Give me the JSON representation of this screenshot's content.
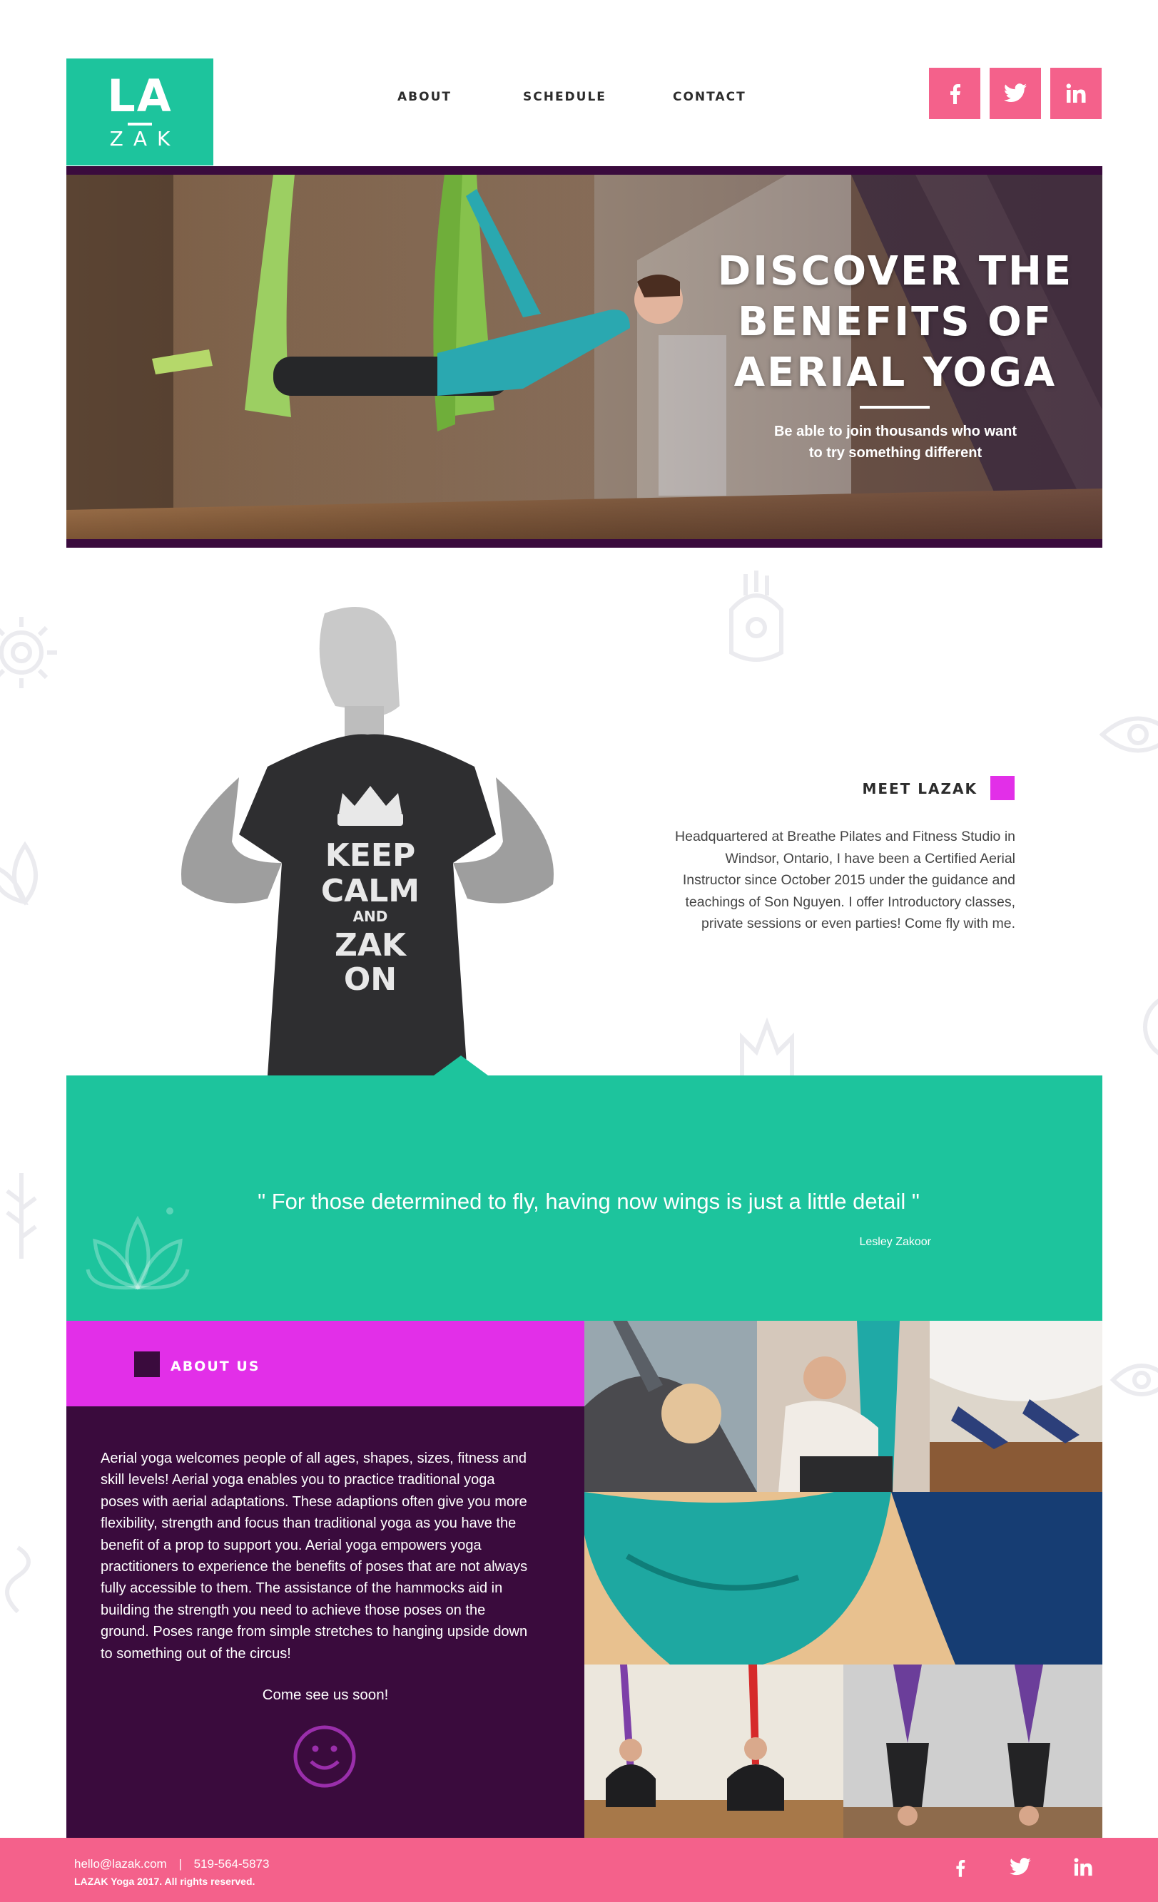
{
  "brand": {
    "logo_top": "LA",
    "logo_bottom": "ZAK",
    "accent_teal": "#1dc49d",
    "accent_pink": "#f4618b",
    "accent_magenta": "#e22fe8",
    "accent_plum": "#3a0b3d"
  },
  "nav": {
    "items": [
      "ABOUT",
      "SCHEDULE",
      "CONTACT"
    ]
  },
  "social": [
    "facebook-icon",
    "twitter-icon",
    "linkedin-icon"
  ],
  "hero": {
    "title_lines": [
      "DISCOVER THE",
      "BENEFITS OF",
      "AERIAL YOGA"
    ],
    "subtitle_lines": [
      "Be able to join thousands who want",
      "to try something different"
    ]
  },
  "meet": {
    "heading": "MEET LAZAK",
    "shirt_lines": [
      "KEEP",
      "CALM",
      "AND",
      "ZAK",
      "ON"
    ],
    "text_lines": [
      "Headquartered at Breathe Pilates and Fitness Studio in",
      "Windsor, Ontario, I have been a Certified Aerial",
      "Instructor since October 2015 under the guidance and",
      "teachings of Son Nguyen. I offer Introductory classes,",
      "private sessions or even parties! Come fly with me."
    ]
  },
  "quote": {
    "text": "\" For those determined to fly, having now wings is just a little detail \"",
    "author": "Lesley Zakoor"
  },
  "about": {
    "title": "ABOUT US",
    "text_lines": [
      "Aerial yoga welcomes people of all ages, shapes, sizes, fitness and",
      "skill levels! Aerial yoga enables you to practice traditional yoga",
      "poses with aerial adaptations. These adaptions often give you more",
      "flexibility, strength and focus than traditional yoga as you have the",
      "benefit of a prop to support you. Aerial yoga empowers yoga",
      "practitioners to experience the benefits of poses that are not always",
      "fully accessible to them. The assistance of the hammocks aid in",
      "building the strength you need to achieve those poses on the",
      "ground. Poses range from simple stretches to hanging upside down",
      "to something out of the circus!"
    ],
    "cta": "Come see us soon!"
  },
  "footer": {
    "email": "hello@lazak.com",
    "separator": "|",
    "phone": "519-564-5873",
    "copyright": "LAZAK Yoga 2017. All rights reserved."
  }
}
